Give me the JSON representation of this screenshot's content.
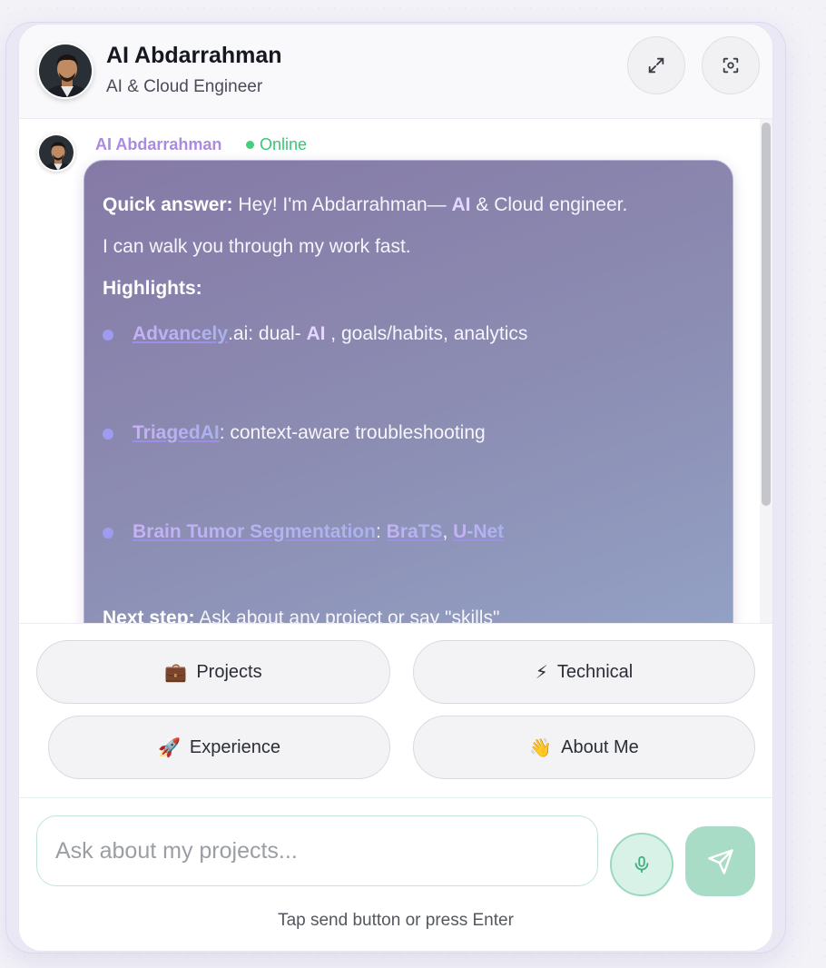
{
  "header": {
    "name": "AI Abdarrahman",
    "role": "AI & Cloud Engineer",
    "expand_icon": "expand-icon",
    "focus_icon": "focus-icon"
  },
  "message": {
    "sender": "AI Abdarrahman",
    "status": "Online",
    "quick_label": "Quick answer:",
    "quick_text_a": "Hey! I'm Abdarrahman— ",
    "quick_ai": "AI",
    "quick_text_b": "  & Cloud engineer.",
    "quick_text_c": "I can walk you through my work fast.",
    "highlights_title": "Highlights:",
    "highlights": [
      {
        "link": "Advancely",
        "text_a": ".ai: dual- ",
        "ai": "AI",
        "text_b": " , goals/habits, analytics"
      },
      {
        "link": "TriagedAI",
        "text_a": ": context-aware troubleshooting"
      },
      {
        "link": "Brain Tumor Segmentation",
        "sep": ": ",
        "link2": "BraTS",
        "comma": ", ",
        "link3": "U-Net"
      }
    ],
    "next_label": "Next step:",
    "next_text": " Ask about any project or say \"skills\""
  },
  "quick_buttons": [
    {
      "emoji": "💼",
      "label": "Projects"
    },
    {
      "emoji": "⚡",
      "label": "Technical"
    },
    {
      "emoji": "🚀",
      "label": "Experience"
    },
    {
      "emoji": "👋",
      "label": "About Me"
    }
  ],
  "composer": {
    "placeholder": "Ask about my projects...",
    "hint": "Tap send button or press Enter",
    "mic_icon": "microphone-icon",
    "send_icon": "send-icon"
  },
  "colors": {
    "accent_purple": "#a98be0",
    "online_green": "#38c873",
    "send_green": "#a9dcc6"
  }
}
